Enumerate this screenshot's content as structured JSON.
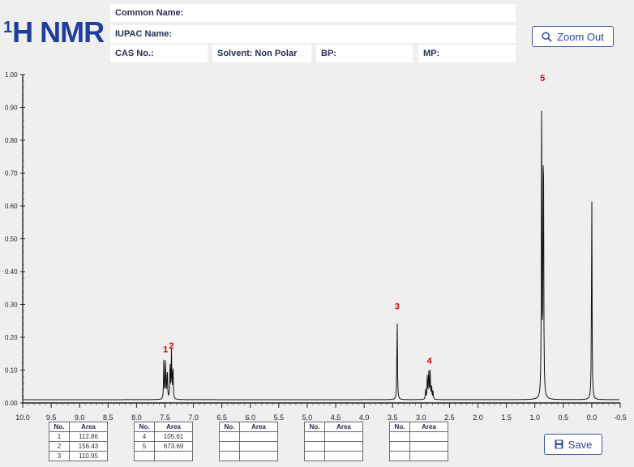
{
  "header": {
    "title_sup": "1",
    "title_main": "H NMR",
    "common_name_label": "Common Name:",
    "common_name_value": "",
    "iupac_name_label": "IUPAC Name:",
    "iupac_name_value": "",
    "cas_label": "CAS No.:",
    "cas_value": "",
    "solvent_label": "Solvent:",
    "solvent_value": "Non Polar",
    "bp_label": "BP:",
    "bp_value": "",
    "mp_label": "MP:",
    "mp_value": ""
  },
  "toolbar": {
    "zoom_out_label": "Zoom Out",
    "save_label": "Save"
  },
  "colors": {
    "title": "#1f3e9c",
    "peak_label": "#e00000",
    "trace": "#111111",
    "button_border": "#3b5aa6"
  },
  "chart_data": {
    "type": "line",
    "xlim": [
      10.0,
      -0.5
    ],
    "ylim": [
      0.0,
      1.0
    ],
    "x_reversed": true,
    "xticks": [
      "10.0",
      "9.5",
      "9.0",
      "8.5",
      "8.0",
      "7.5",
      "7.0",
      "6.5",
      "6.0",
      "5.5",
      "5.0",
      "4.5",
      "4.0",
      "3.5",
      "3.0",
      "2.5",
      "2.0",
      "1.5",
      "1.0",
      "0.5",
      "0.0",
      "-0.5"
    ],
    "yticks": [
      "0.00",
      "0.10",
      "0.20",
      "0.30",
      "0.40",
      "0.50",
      "0.60",
      "0.70",
      "0.80",
      "0.90",
      "1.00"
    ],
    "baseline": 0.01,
    "peaks": [
      {
        "label": "1",
        "lines": [
          {
            "ppm": 7.52,
            "height": 0.12
          },
          {
            "ppm": 7.49,
            "height": 0.135
          },
          {
            "ppm": 7.46,
            "height": 0.1
          }
        ]
      },
      {
        "label": "2",
        "lines": [
          {
            "ppm": 7.41,
            "height": 0.125
          },
          {
            "ppm": 7.385,
            "height": 0.145
          },
          {
            "ppm": 7.36,
            "height": 0.11
          }
        ]
      },
      {
        "label": "3",
        "lines": [
          {
            "ppm": 3.42,
            "height": 0.265
          }
        ]
      },
      {
        "label": "4",
        "lines": [
          {
            "ppm": 2.92,
            "height": 0.03
          },
          {
            "ppm": 2.89,
            "height": 0.07
          },
          {
            "ppm": 2.865,
            "height": 0.1
          },
          {
            "ppm": 2.84,
            "height": 0.085
          },
          {
            "ppm": 2.815,
            "height": 0.045
          },
          {
            "ppm": 2.79,
            "height": 0.025
          }
        ]
      },
      {
        "label": "5",
        "lines": [
          {
            "ppm": 0.88,
            "height": 0.96
          },
          {
            "ppm": 0.85,
            "height": 0.94
          }
        ]
      },
      {
        "label": "",
        "lines": [
          {
            "ppm": 0.0,
            "height": 0.64
          }
        ]
      }
    ],
    "peak_table_headers": [
      "No.",
      "Area"
    ],
    "peak_tables": [
      [
        [
          "1",
          "112.86"
        ],
        [
          "2",
          "156.43"
        ],
        [
          "3",
          "110.95"
        ]
      ],
      [
        [
          "4",
          "105.61"
        ],
        [
          "5",
          "673.69"
        ],
        [
          "",
          ""
        ]
      ],
      [
        [
          "",
          ""
        ],
        [
          "",
          ""
        ],
        [
          "",
          ""
        ]
      ],
      [
        [
          "",
          ""
        ],
        [
          "",
          ""
        ],
        [
          "",
          ""
        ]
      ],
      [
        [
          "",
          ""
        ],
        [
          "",
          ""
        ],
        [
          "",
          ""
        ]
      ]
    ]
  }
}
